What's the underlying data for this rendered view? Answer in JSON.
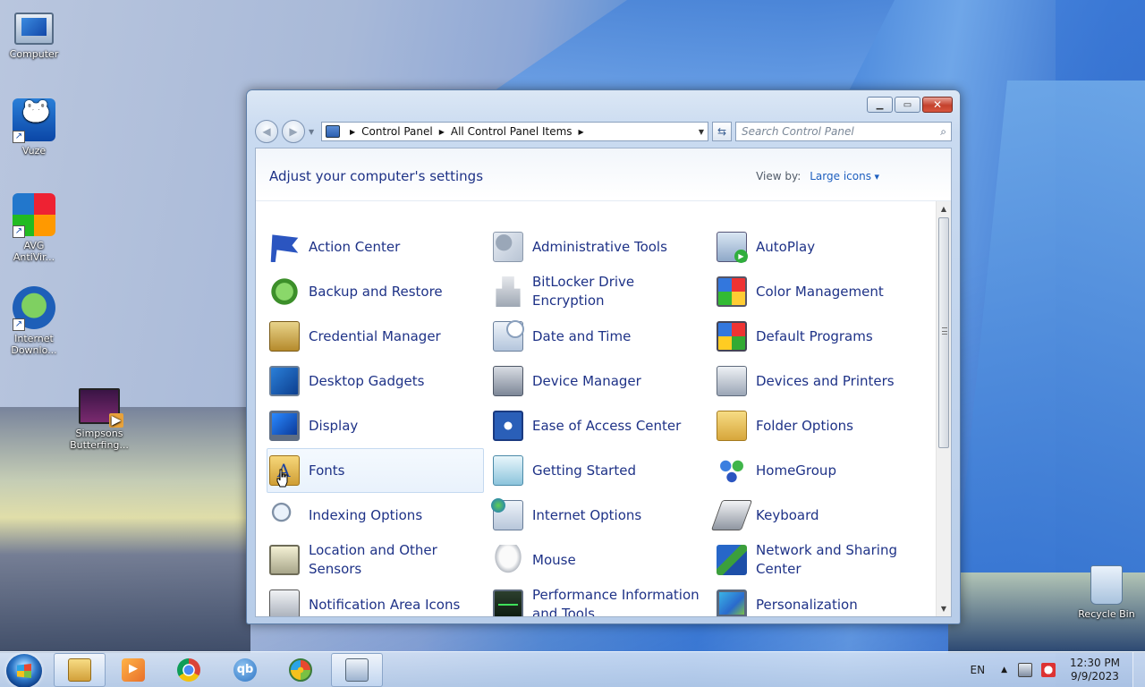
{
  "desktop": {
    "icons": [
      {
        "label": "Computer",
        "icon": "computer-icon"
      },
      {
        "label": "Vuze",
        "icon": "vuze-icon"
      },
      {
        "label": "AVG AntiVir...",
        "icon": "avg-icon"
      },
      {
        "label": "Internet Downlo...",
        "icon": "internet-download-manager-icon"
      },
      {
        "label": "Simpsons Butterfing...",
        "icon": "video-file-icon"
      },
      {
        "label": "Recycle Bin",
        "icon": "recycle-bin-icon"
      }
    ]
  },
  "window": {
    "breadcrumb": [
      "Control Panel",
      "All Control Panel Items"
    ],
    "search_placeholder": "Search Control Panel",
    "heading": "Adjust your computer's settings",
    "view_by_label": "View by:",
    "view_by_value": "Large icons",
    "items": [
      {
        "label": "Action Center",
        "icon": "action-center-flag-icon"
      },
      {
        "label": "Administrative Tools",
        "icon": "administrative-tools-icon"
      },
      {
        "label": "AutoPlay",
        "icon": "autoplay-icon"
      },
      {
        "label": "Backup and Restore",
        "icon": "backup-restore-icon"
      },
      {
        "label": "BitLocker Drive Encryption",
        "icon": "bitlocker-icon"
      },
      {
        "label": "Color Management",
        "icon": "color-management-icon"
      },
      {
        "label": "Credential Manager",
        "icon": "credential-manager-icon"
      },
      {
        "label": "Date and Time",
        "icon": "date-time-icon"
      },
      {
        "label": "Default Programs",
        "icon": "default-programs-icon"
      },
      {
        "label": "Desktop Gadgets",
        "icon": "desktop-gadgets-icon"
      },
      {
        "label": "Device Manager",
        "icon": "device-manager-icon"
      },
      {
        "label": "Devices and Printers",
        "icon": "devices-printers-icon"
      },
      {
        "label": "Display",
        "icon": "display-icon"
      },
      {
        "label": "Ease of Access Center",
        "icon": "ease-of-access-icon"
      },
      {
        "label": "Folder Options",
        "icon": "folder-options-icon"
      },
      {
        "label": "Fonts",
        "icon": "fonts-icon"
      },
      {
        "label": "Getting Started",
        "icon": "getting-started-icon"
      },
      {
        "label": "HomeGroup",
        "icon": "homegroup-icon"
      },
      {
        "label": "Indexing Options",
        "icon": "indexing-options-icon"
      },
      {
        "label": "Internet Options",
        "icon": "internet-options-icon"
      },
      {
        "label": "Keyboard",
        "icon": "keyboard-icon"
      },
      {
        "label": "Location and Other Sensors",
        "icon": "location-sensors-icon"
      },
      {
        "label": "Mouse",
        "icon": "mouse-icon"
      },
      {
        "label": "Network and Sharing Center",
        "icon": "network-sharing-icon"
      },
      {
        "label": "Notification Area Icons",
        "icon": "notification-area-icon"
      },
      {
        "label": "Performance Information and Tools",
        "icon": "performance-icon"
      },
      {
        "label": "Personalization",
        "icon": "personalization-icon"
      }
    ],
    "hovered_item": "Fonts"
  },
  "taskbar": {
    "apps": [
      {
        "name": "Windows Explorer",
        "icon": "explorer-folder-icon"
      },
      {
        "name": "Media Player",
        "icon": "media-player-icon"
      },
      {
        "name": "Google Chrome",
        "icon": "chrome-icon"
      },
      {
        "name": "qBittorrent",
        "icon": "qbittorrent-icon",
        "glyph": "qb"
      },
      {
        "name": "Windows",
        "icon": "windows-logo-icon"
      },
      {
        "name": "Control Panel",
        "icon": "control-panel-icon"
      }
    ],
    "language": "EN",
    "time": "12:30 PM",
    "date": "9/9/2023"
  }
}
